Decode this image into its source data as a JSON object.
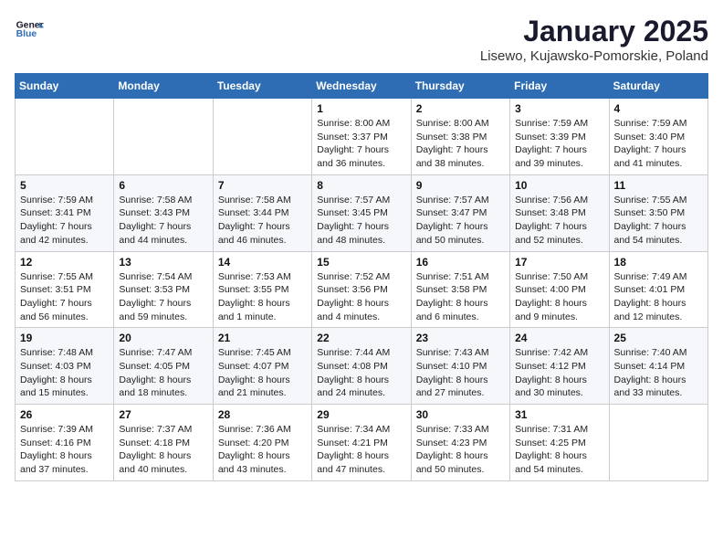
{
  "logo": {
    "line1": "General",
    "line2": "Blue"
  },
  "title": "January 2025",
  "location": "Lisewo, Kujawsko-Pomorskie, Poland",
  "days_of_week": [
    "Sunday",
    "Monday",
    "Tuesday",
    "Wednesday",
    "Thursday",
    "Friday",
    "Saturday"
  ],
  "weeks": [
    [
      {
        "day": "",
        "info": ""
      },
      {
        "day": "",
        "info": ""
      },
      {
        "day": "",
        "info": ""
      },
      {
        "day": "1",
        "info": "Sunrise: 8:00 AM\nSunset: 3:37 PM\nDaylight: 7 hours and 36 minutes."
      },
      {
        "day": "2",
        "info": "Sunrise: 8:00 AM\nSunset: 3:38 PM\nDaylight: 7 hours and 38 minutes."
      },
      {
        "day": "3",
        "info": "Sunrise: 7:59 AM\nSunset: 3:39 PM\nDaylight: 7 hours and 39 minutes."
      },
      {
        "day": "4",
        "info": "Sunrise: 7:59 AM\nSunset: 3:40 PM\nDaylight: 7 hours and 41 minutes."
      }
    ],
    [
      {
        "day": "5",
        "info": "Sunrise: 7:59 AM\nSunset: 3:41 PM\nDaylight: 7 hours and 42 minutes."
      },
      {
        "day": "6",
        "info": "Sunrise: 7:58 AM\nSunset: 3:43 PM\nDaylight: 7 hours and 44 minutes."
      },
      {
        "day": "7",
        "info": "Sunrise: 7:58 AM\nSunset: 3:44 PM\nDaylight: 7 hours and 46 minutes."
      },
      {
        "day": "8",
        "info": "Sunrise: 7:57 AM\nSunset: 3:45 PM\nDaylight: 7 hours and 48 minutes."
      },
      {
        "day": "9",
        "info": "Sunrise: 7:57 AM\nSunset: 3:47 PM\nDaylight: 7 hours and 50 minutes."
      },
      {
        "day": "10",
        "info": "Sunrise: 7:56 AM\nSunset: 3:48 PM\nDaylight: 7 hours and 52 minutes."
      },
      {
        "day": "11",
        "info": "Sunrise: 7:55 AM\nSunset: 3:50 PM\nDaylight: 7 hours and 54 minutes."
      }
    ],
    [
      {
        "day": "12",
        "info": "Sunrise: 7:55 AM\nSunset: 3:51 PM\nDaylight: 7 hours and 56 minutes."
      },
      {
        "day": "13",
        "info": "Sunrise: 7:54 AM\nSunset: 3:53 PM\nDaylight: 7 hours and 59 minutes."
      },
      {
        "day": "14",
        "info": "Sunrise: 7:53 AM\nSunset: 3:55 PM\nDaylight: 8 hours and 1 minute."
      },
      {
        "day": "15",
        "info": "Sunrise: 7:52 AM\nSunset: 3:56 PM\nDaylight: 8 hours and 4 minutes."
      },
      {
        "day": "16",
        "info": "Sunrise: 7:51 AM\nSunset: 3:58 PM\nDaylight: 8 hours and 6 minutes."
      },
      {
        "day": "17",
        "info": "Sunrise: 7:50 AM\nSunset: 4:00 PM\nDaylight: 8 hours and 9 minutes."
      },
      {
        "day": "18",
        "info": "Sunrise: 7:49 AM\nSunset: 4:01 PM\nDaylight: 8 hours and 12 minutes."
      }
    ],
    [
      {
        "day": "19",
        "info": "Sunrise: 7:48 AM\nSunset: 4:03 PM\nDaylight: 8 hours and 15 minutes."
      },
      {
        "day": "20",
        "info": "Sunrise: 7:47 AM\nSunset: 4:05 PM\nDaylight: 8 hours and 18 minutes."
      },
      {
        "day": "21",
        "info": "Sunrise: 7:45 AM\nSunset: 4:07 PM\nDaylight: 8 hours and 21 minutes."
      },
      {
        "day": "22",
        "info": "Sunrise: 7:44 AM\nSunset: 4:08 PM\nDaylight: 8 hours and 24 minutes."
      },
      {
        "day": "23",
        "info": "Sunrise: 7:43 AM\nSunset: 4:10 PM\nDaylight: 8 hours and 27 minutes."
      },
      {
        "day": "24",
        "info": "Sunrise: 7:42 AM\nSunset: 4:12 PM\nDaylight: 8 hours and 30 minutes."
      },
      {
        "day": "25",
        "info": "Sunrise: 7:40 AM\nSunset: 4:14 PM\nDaylight: 8 hours and 33 minutes."
      }
    ],
    [
      {
        "day": "26",
        "info": "Sunrise: 7:39 AM\nSunset: 4:16 PM\nDaylight: 8 hours and 37 minutes."
      },
      {
        "day": "27",
        "info": "Sunrise: 7:37 AM\nSunset: 4:18 PM\nDaylight: 8 hours and 40 minutes."
      },
      {
        "day": "28",
        "info": "Sunrise: 7:36 AM\nSunset: 4:20 PM\nDaylight: 8 hours and 43 minutes."
      },
      {
        "day": "29",
        "info": "Sunrise: 7:34 AM\nSunset: 4:21 PM\nDaylight: 8 hours and 47 minutes."
      },
      {
        "day": "30",
        "info": "Sunrise: 7:33 AM\nSunset: 4:23 PM\nDaylight: 8 hours and 50 minutes."
      },
      {
        "day": "31",
        "info": "Sunrise: 7:31 AM\nSunset: 4:25 PM\nDaylight: 8 hours and 54 minutes."
      },
      {
        "day": "",
        "info": ""
      }
    ]
  ]
}
